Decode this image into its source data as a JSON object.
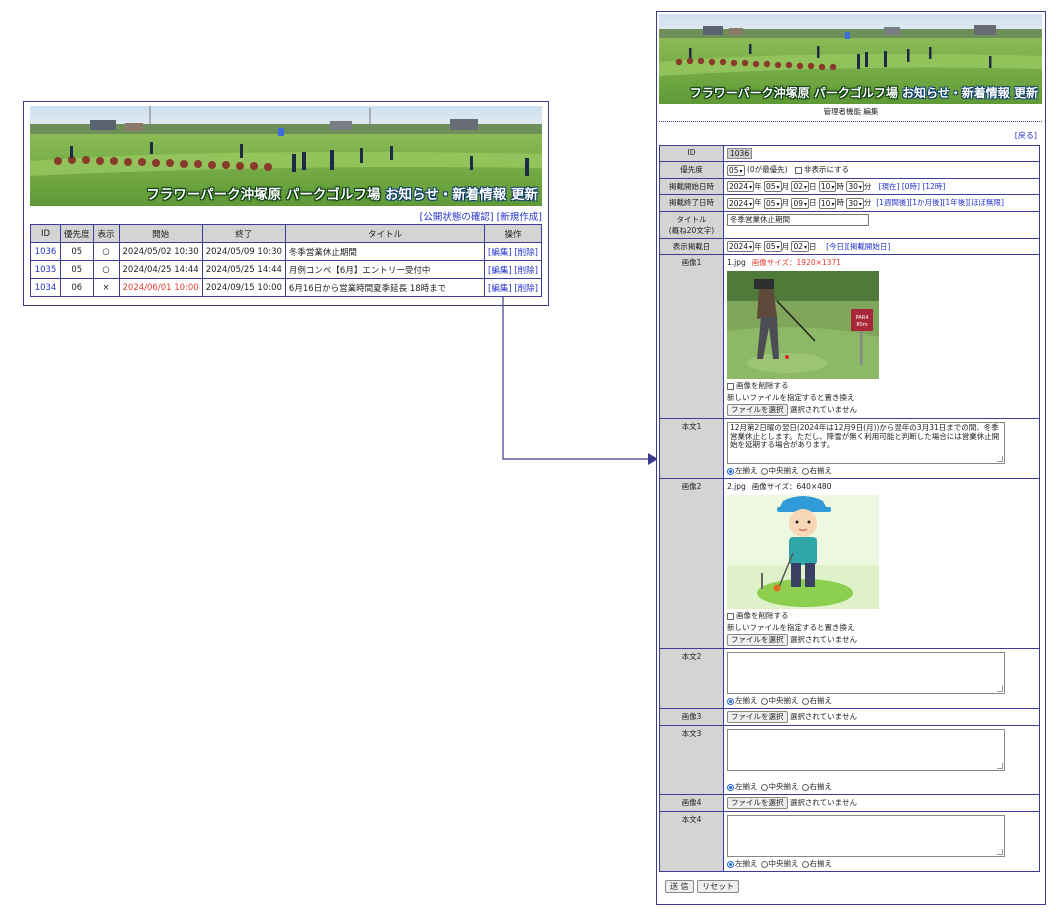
{
  "banner": {
    "title_main": "フラワーパーク沖塚原 パークゴルフ場",
    "title_sub": "お知らせ・新着情報 更新"
  },
  "list_page": {
    "links": {
      "publish_status": "[公開状態の確認]",
      "new_entry": "[新規作成]"
    },
    "columns": [
      "ID",
      "優先度",
      "表示",
      "開始",
      "終了",
      "タイトル",
      "操作"
    ],
    "rows": [
      {
        "id": "1036",
        "priority": "05",
        "display": "○",
        "start": "2024/05/02 10:30",
        "end": "2024/05/09 10:30",
        "title": "冬季営業休止期間",
        "edit": "[編集]",
        "delete": "[削除]"
      },
      {
        "id": "1035",
        "priority": "05",
        "display": "○",
        "start": "2024/04/25 14:44",
        "end": "2024/05/25 14:44",
        "title": "月例コンペ【6月】エントリー受付中",
        "edit": "[編集]",
        "delete": "[削除]"
      },
      {
        "id": "1034",
        "priority": "06",
        "display": "×",
        "start": "2024/06/01 10:00",
        "end": "2024/09/15 10:00",
        "title": "6月16日から営業時間夏季延長 18時まで",
        "edit": "[編集]",
        "delete": "[削除]"
      }
    ]
  },
  "edit_page": {
    "subtitle": "管理者機能 編集",
    "back_link": "[戻る]",
    "labels": {
      "id": "ID",
      "priority": "優先度",
      "start": "掲載開始日時",
      "end": "掲載終了日時",
      "title": "タイトル",
      "title_note": "(概ね20文字)",
      "display_date": "表示掲載日",
      "image1": "画像1",
      "body1": "本文1",
      "image2": "画像2",
      "body2": "本文2",
      "image3": "画像3",
      "body3": "本文3",
      "image4": "画像4",
      "body4": "本文4"
    },
    "id_value": "1036",
    "priority": {
      "value": "05",
      "note": "(0が最優先)",
      "hide_label": "非表示にする"
    },
    "start": {
      "year": "2024",
      "month": "05",
      "day": "02",
      "hour": "10",
      "minute": "30",
      "shortcuts": [
        "[現在]",
        "[0時]",
        "[12時]"
      ]
    },
    "end": {
      "year": "2024",
      "month": "05",
      "day": "09",
      "hour": "10",
      "minute": "30",
      "shortcuts": [
        "[1週間後]",
        "[1か月後]",
        "[1年後]",
        "[ほぼ無限]"
      ]
    },
    "units": {
      "year": "年",
      "month": "月",
      "day": "日",
      "hour": "時",
      "minute": "分"
    },
    "title_value": "冬季営業休止期間",
    "display_date": {
      "year": "2024",
      "month": "05",
      "day": "02",
      "today": "[今日]",
      "start_date": "[掲載開始日]"
    },
    "image1": {
      "filename": "1.jpg",
      "size": "画像サイズ：1920×1371"
    },
    "image2": {
      "filename": "2.jpg",
      "size": "画像サイズ：640×480"
    },
    "delete_image": "画像を削除する",
    "replace_note": "新しいファイルを指定すると置き換え",
    "file_button": "ファイルを選択",
    "no_file": "選択されていません",
    "body1_text": "12月第2日曜の翌日(2024年は12月9日(月))から翌年の3月31日までの間、冬季営業休止とします。ただし、降雪が無く利用可能と判断した場合には営業休止開始を延期する場合があります。",
    "align": {
      "left": "左揃え",
      "center": "中央揃え",
      "right": "右揃え"
    },
    "submit": "送 信",
    "reset": "リセット"
  },
  "colors": {
    "border": "#3b3b8f",
    "label_bg": "#d4d4d4",
    "link": "#2233cc",
    "red": "#e23b2e"
  }
}
